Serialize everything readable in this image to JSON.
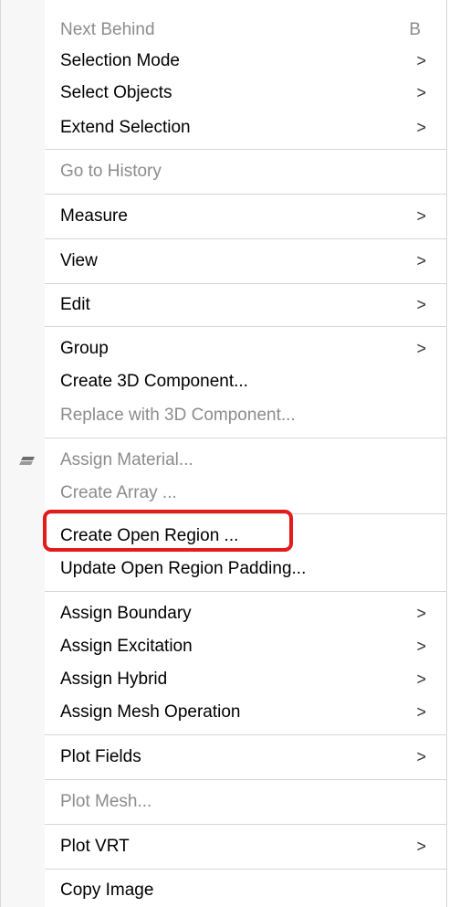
{
  "menu": {
    "items": [
      {
        "label": "Next Behind",
        "shortcut": "B",
        "disabled": true
      },
      {
        "label": "Selection Mode",
        "submenu": true
      },
      {
        "label": "Select Objects",
        "submenu": true
      },
      {
        "label": "Extend Selection",
        "submenu": true
      },
      {
        "label": "Go to History",
        "disabled": true
      },
      {
        "label": "Measure",
        "submenu": true
      },
      {
        "label": "View",
        "submenu": true
      },
      {
        "label": "Edit",
        "submenu": true
      },
      {
        "label": "Group",
        "submenu": true
      },
      {
        "label": "Create 3D Component..."
      },
      {
        "label": "Replace with 3D Component...",
        "disabled": true
      },
      {
        "label": "Assign Material...",
        "disabled": true,
        "icon": "material-icon"
      },
      {
        "label": "Create Array ...",
        "disabled": true
      },
      {
        "label": "Create Open Region ...",
        "highlighted": true
      },
      {
        "label": "Update Open Region Padding..."
      },
      {
        "label": "Assign Boundary",
        "submenu": true
      },
      {
        "label": "Assign Excitation",
        "submenu": true
      },
      {
        "label": "Assign Hybrid",
        "submenu": true
      },
      {
        "label": "Assign Mesh Operation",
        "submenu": true
      },
      {
        "label": "Plot Fields",
        "submenu": true
      },
      {
        "label": "Plot Mesh...",
        "disabled": true
      },
      {
        "label": "Plot VRT",
        "submenu": true
      },
      {
        "label": "Copy Image"
      }
    ],
    "submenu_glyph": ">",
    "colors": {
      "enabled_text": "#000000",
      "disabled_text": "#8c8c8c",
      "highlight_outline": "#e31b1b",
      "separator": "#d6d6d6"
    }
  }
}
